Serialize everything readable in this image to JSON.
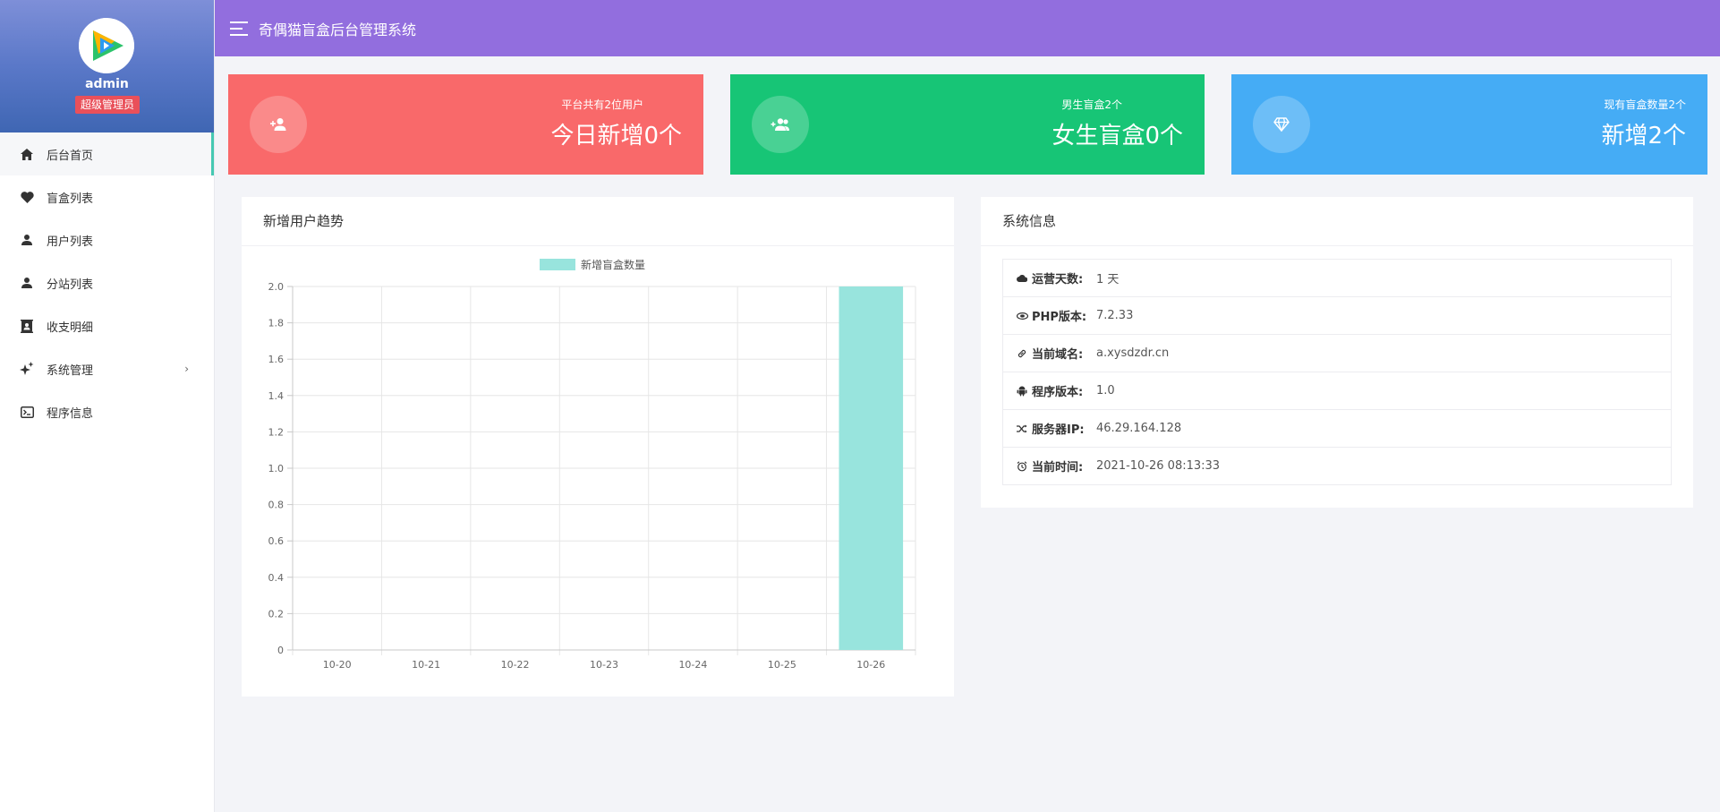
{
  "sidebar": {
    "username": "admin",
    "role": "超级管理员",
    "items": [
      {
        "label": "后台首页",
        "icon": "home-icon"
      },
      {
        "label": "盲盒列表",
        "icon": "heart-icon"
      },
      {
        "label": "用户列表",
        "icon": "user-icon"
      },
      {
        "label": "分站列表",
        "icon": "user-icon"
      },
      {
        "label": "收支明细",
        "icon": "contact-icon"
      },
      {
        "label": "系统管理",
        "icon": "sparkle-icon"
      },
      {
        "label": "程序信息",
        "icon": "terminal-icon"
      }
    ]
  },
  "header": {
    "title": "奇偶猫盲盒后台管理系统"
  },
  "cards": [
    {
      "small": "平台共有2位用户",
      "big": "今日新增0个",
      "color": "#f9696a",
      "icon": "add-user-icon"
    },
    {
      "small": "男生盲盒2个",
      "big": "女生盲盒0个",
      "color": "#17c576",
      "icon": "group-add-icon"
    },
    {
      "small": "现有盲盒数量2个",
      "big": "新增2个",
      "color": "#45acf5",
      "icon": "diamond-icon"
    }
  ],
  "chart_panel": {
    "title": "新增用户趋势"
  },
  "info_panel": {
    "title": "系统信息",
    "rows": [
      {
        "label": "运营天数:",
        "value": "1 天",
        "icon": "cloud-icon"
      },
      {
        "label": "PHP版本:",
        "value": "7.2.33",
        "icon": "eye-icon"
      },
      {
        "label": "当前域名:",
        "value": "a.xysdzdr.cn",
        "icon": "link-icon"
      },
      {
        "label": "程序版本:",
        "value": "1.0",
        "icon": "android-icon"
      },
      {
        "label": "服务器IP:",
        "value": "46.29.164.128",
        "icon": "shuffle-icon"
      },
      {
        "label": "当前时间:",
        "value": "2021-10-26 08:13:33",
        "icon": "alarm-icon"
      }
    ]
  },
  "chart_data": {
    "type": "bar",
    "categories": [
      "10-20",
      "10-21",
      "10-22",
      "10-23",
      "10-24",
      "10-25",
      "10-26"
    ],
    "series": [
      {
        "name": "新增盲盒数量",
        "values": [
          0,
          0,
          0,
          0,
          0,
          0,
          2
        ],
        "color": "#98e4dd"
      }
    ],
    "title": "",
    "xlabel": "",
    "ylabel": "",
    "ylim": [
      0,
      2.0
    ],
    "yticks": [
      "0",
      "0.2",
      "0.4",
      "0.6",
      "0.8",
      "1.0",
      "1.2",
      "1.4",
      "1.6",
      "1.8",
      "2.0"
    ],
    "grid": true,
    "legend": "top-center"
  }
}
